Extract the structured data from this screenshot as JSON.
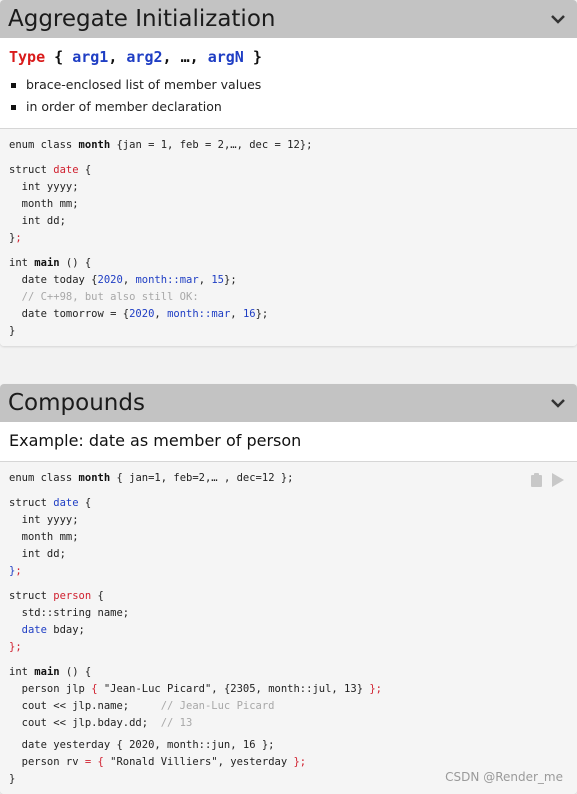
{
  "section1": {
    "title": "Aggregate Initialization",
    "sig": {
      "type": "Type",
      "open": "{",
      "arg1": "arg1",
      "comma1": ",",
      "arg2": "arg2",
      "comma2": ",",
      "dots": "…,",
      "argN": "argN",
      "close": "}"
    },
    "bullets": [
      "brace-enclosed list of member values",
      "in order of member declaration"
    ],
    "code": {
      "l1a": "enum class ",
      "l1b": "month",
      "l1c": " {jan = 1, feb = 2,…, dec = 12};",
      "l2a": "struct ",
      "l2b": "date",
      "l2c": " {",
      "l3": "  int yyyy;",
      "l4": "  month mm;",
      "l5": "  int dd;",
      "l6a": "}",
      "l6b": ";",
      "l7a": "int ",
      "l7b": "main",
      "l7c": " () {",
      "l8a": "  date today {",
      "l8b": "2020",
      "l8c": ", ",
      "l8d": "month::mar",
      "l8e": ", ",
      "l8f": "15",
      "l8g": "};",
      "l9": "  // C++98, but also still OK:",
      "l10a": "  date tomorrow = {",
      "l10b": "2020",
      "l10c": ", ",
      "l10d": "month::mar",
      "l10e": ", ",
      "l10f": "16",
      "l10g": "};",
      "l11": "}"
    }
  },
  "section2": {
    "title": "Compounds",
    "example": "Example: date as member of person",
    "code": {
      "l1a": "enum class ",
      "l1b": "month",
      "l1c": " { jan=1, feb=2,… , dec=12 };",
      "l2a": "struct ",
      "l2b": "date",
      "l2c": " {",
      "l3": "  int yyyy;",
      "l4": "  month mm;",
      "l5": "  int dd;",
      "l6a": "}",
      "l6b": ";",
      "l7a": "struct ",
      "l7b": "person",
      "l7c": " {",
      "l8": "  std::string name;",
      "l9a": "  ",
      "l9b": "date",
      "l9c": " bday;",
      "l10a": "}",
      "l10b": ";",
      "l11a": "int ",
      "l11b": "main",
      "l11c": " () {",
      "l12a": "  person jlp ",
      "l12b": "{",
      "l12c": " \"Jean-Luc Picard\", {2305, month::jul, 13} ",
      "l12d": "};",
      "l13a": "  cout << jlp.name;     ",
      "l13b": "// Jean-Luc Picard",
      "l14a": "  cout << jlp.bday.dd;  ",
      "l14b": "// 13",
      "l15": "  date yesterday { 2020, month::jun, 16 };",
      "l16a": "  person rv ",
      "l16b": "= {",
      "l16c": " \"Ronald Villiers\", yesterday ",
      "l16d": "};",
      "l17": "}"
    }
  },
  "watermark": "CSDN @Render_me",
  "icons": {
    "collapse": "chevron-down-icon",
    "copy": "clipboard-icon",
    "run": "play-icon"
  }
}
